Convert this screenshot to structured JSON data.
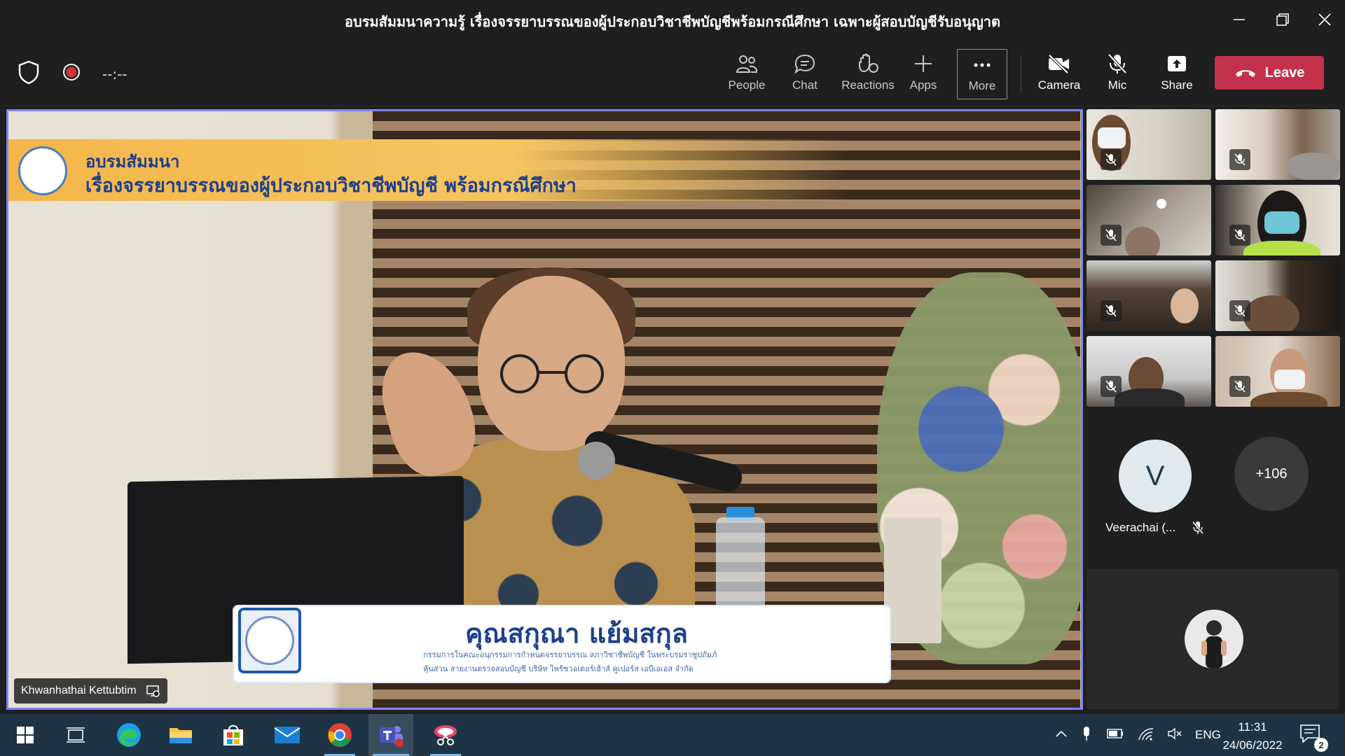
{
  "window": {
    "title": "อบรมสัมมนาความรู้ เรื่องจรรยาบรรณของผู้ประกอบวิชาชีพบัญชีพร้อมกรณีศึกษา เฉพาะผู้สอบบัญชีรับอนุญาต"
  },
  "toolbar": {
    "timer": "--:--",
    "items": [
      {
        "label": "People",
        "icon": "people-icon"
      },
      {
        "label": "Chat",
        "icon": "chat-icon"
      },
      {
        "label": "Reactions",
        "icon": "reactions-icon"
      },
      {
        "label": "Apps",
        "icon": "apps-icon"
      },
      {
        "label": "More",
        "icon": "more-icon"
      },
      {
        "label": "Camera",
        "icon": "camera-off-icon"
      },
      {
        "label": "Mic",
        "icon": "mic-off-icon"
      },
      {
        "label": "Share",
        "icon": "share-icon"
      }
    ],
    "leave_label": "Leave",
    "leave_color": "#c4314b"
  },
  "stage": {
    "banner_line1": "อบรมสัมมนา",
    "banner_line2": "เรื่องจรรยาบรรณของผู้ประกอบวิชาชีพบัญชี พร้อมกรณีศึกษา",
    "nameplate_name": "คุณสกุณา แย้มสกุล",
    "nameplate_sub1": "กรรมการในคณะอนุกรรมการกำหนดจรรยาบรรณ สภาวิชาชีพบัญชี ในพระบรมราชูปถัมภ์",
    "nameplate_sub2": "หุ้นส่วน สายงานตรวจสอบบัญชี บริษัท ไพร้ซวอเตอร์เฮ้าส์ คูเปอร์ส เอบีเอเอส จำกัด",
    "speaker_name": "Khwanhathai Kettubtim",
    "highlight_color": "#7f85f5"
  },
  "participants": {
    "avatar_initial": "V",
    "avatar_name": "Veerachai (...",
    "overflow_count": "+106"
  },
  "taskbar": {
    "language": "ENG",
    "time": "11:31",
    "date": "24/06/2022",
    "notification_count": "2"
  }
}
